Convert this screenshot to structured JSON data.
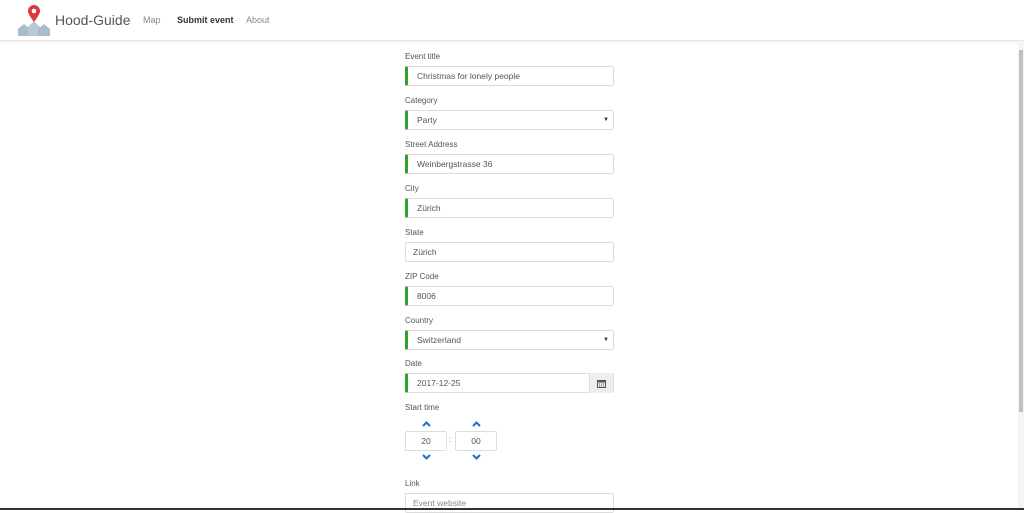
{
  "nav": {
    "brand": "Hood-Guide",
    "links": [
      {
        "label": "Map"
      },
      {
        "label": "Submit event"
      },
      {
        "label": "About"
      }
    ]
  },
  "form": {
    "event_title": {
      "label": "Event title",
      "value": "Christmas for lonely people"
    },
    "category": {
      "label": "Category",
      "value": "Party"
    },
    "street": {
      "label": "Street Address",
      "value": "Weinbergstrasse 36"
    },
    "city": {
      "label": "City",
      "value": "Zürich"
    },
    "state": {
      "label": "State",
      "value": "Zürich"
    },
    "zip": {
      "label": "ZIP Code",
      "value": "8006"
    },
    "country": {
      "label": "Country",
      "value": "Switzerland"
    },
    "date": {
      "label": "Date",
      "value": "2017-12-25"
    },
    "start_time": {
      "label": "Start time",
      "hours": "20",
      "minutes": "00",
      "separator": ":"
    },
    "link": {
      "label": "Link",
      "placeholder": "Event website"
    }
  },
  "colors": {
    "valid": "#2aa52a",
    "accent": "#1a6fc4"
  }
}
